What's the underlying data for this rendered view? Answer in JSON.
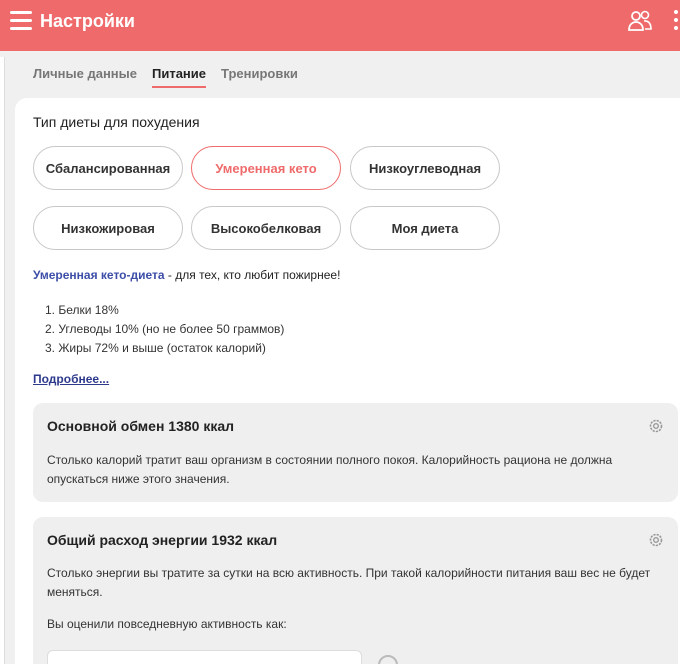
{
  "header": {
    "title": "Настройки",
    "menu_icon": "hamburger-icon",
    "users_icon": "users-icon",
    "more_icon": "kebab-icon"
  },
  "tabs": [
    {
      "label": "Личные данные",
      "active": false
    },
    {
      "label": "Питание",
      "active": true
    },
    {
      "label": "Тренировки",
      "active": false
    }
  ],
  "diet": {
    "section_title": "Тип диеты для похудения",
    "options": [
      {
        "label": "Сбалансированная",
        "active": false
      },
      {
        "label": "Умеренная кето",
        "active": true
      },
      {
        "label": "Низкоуглеводная",
        "active": false
      },
      {
        "label": "Низкожировая",
        "active": false
      },
      {
        "label": "Высокобелковая",
        "active": false
      },
      {
        "label": "Моя диета",
        "active": false
      }
    ],
    "selected_name": "Умеренная кето-диета",
    "selected_desc": " - для тех, кто любит пожирнее!",
    "macros": [
      "1. Белки 18%",
      "2. Углеводы 10% (но не более 50 граммов)",
      "3. Жиры 72% и выше (остаток калорий)"
    ],
    "more_link": "Подробнее..."
  },
  "bmr": {
    "title": "Основной обмен 1380 ккал",
    "text": "Столько калорий тратит ваш организм в состоянии полного покоя. Калорийность рациона не должна опускаться ниже этого значения."
  },
  "tdee": {
    "title": "Общий расход энергии 1932 ккал",
    "text": "Столько энергии вы тратите за сутки на всю активность. При такой калорийности питания ваш вес не будет меняться.",
    "activity_prompt": "Вы оценили повседневную активность как:"
  },
  "colors": {
    "accent": "#ef6b6b",
    "link": "#2d3a8c"
  }
}
